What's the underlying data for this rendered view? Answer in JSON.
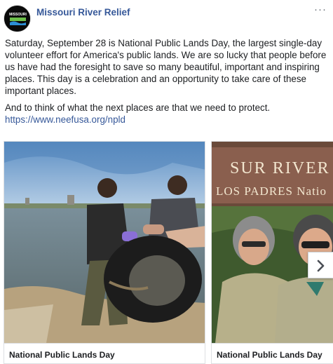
{
  "post": {
    "page_name": "Missouri River Relief",
    "avatar_label": "MISSOURI",
    "paragraph_1": "Saturday, September 28 is National Public Lands Day, the largest single-day volunteer effort for America's public lands. We are so lucky that people before us have had the foresight to save so many beautiful, important and inspiring places. This day is a celebration and an opportunity to take care of these important places.",
    "paragraph_2": "And to think of what the next places are that we need to protect.",
    "link": "https://www.neefusa.org/npld",
    "more_icon": "ellipsis-icon"
  },
  "carousel": {
    "cards": [
      {
        "caption": "National Public Lands Day",
        "photo": "volunteers-lifting-tire-river-photo",
        "sign_text": ""
      },
      {
        "caption": "National Public Lands Day",
        "photo": "forest-rangers-sign-photo",
        "sign_line_1": "SUR RIVER",
        "sign_line_2": "LOS PADRES Natio"
      }
    ],
    "next_icon": "chevron-right-icon"
  },
  "colors": {
    "link": "#365899",
    "text": "#1c1e21",
    "border": "#dddfe2"
  }
}
